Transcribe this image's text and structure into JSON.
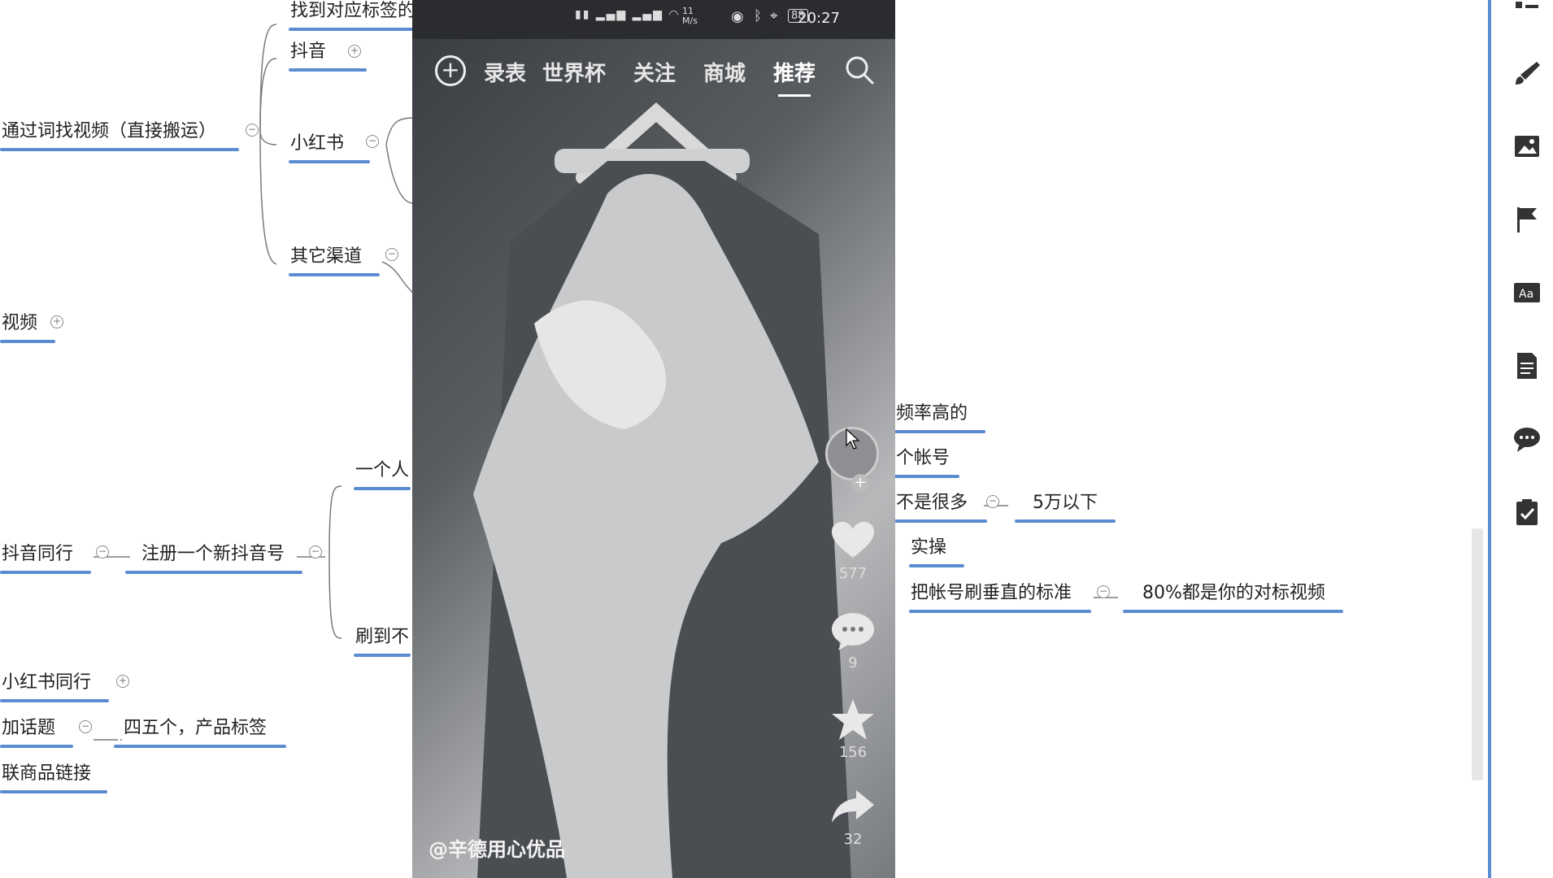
{
  "mindmap": {
    "nodes": {
      "find_tag": "找到对应标签的",
      "douyin": "抖音",
      "search_video": "通过词找视频（直接搬运）",
      "xiaohongshu": "小红书",
      "other_channels": "其它渠道",
      "video": "视频",
      "one_person": "一个人",
      "douyin_peers": "抖音同行",
      "register_new": "注册一个新抖音号",
      "scroll_to": "刷到不",
      "freq_high": "频率高的",
      "one_account": "个帐号",
      "not_many": "不是很多",
      "under_50k": "5万以下",
      "practice": "实操",
      "vertical": "把帐号刷垂直的标准",
      "eighty_percent": "80%都是你的对标视频",
      "xhs_peers": "小红书同行",
      "add_topic": "加话题",
      "four_five": "四五个，产品标签",
      "link_product": "联商品链接"
    },
    "accent_color": "#5b8bd1"
  },
  "phone": {
    "status": {
      "time": "20:27",
      "battery": "88",
      "speed": "11 M/s"
    },
    "tabs": [
      "录表",
      "世界杯",
      "关注",
      "商城",
      "推荐"
    ],
    "active_tab": "推荐",
    "metrics": {
      "likes": "577",
      "comments": "9",
      "favorites": "156",
      "shares": "32"
    },
    "author": "@辛德用心优品"
  },
  "toolbar": {
    "icons": [
      "outline-icon",
      "brush-icon",
      "image-icon",
      "flag-icon",
      "text-style-icon",
      "note-icon",
      "comment-icon",
      "task-icon"
    ]
  }
}
